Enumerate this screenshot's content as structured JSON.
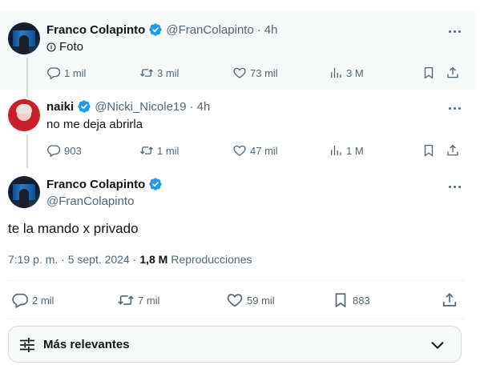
{
  "tweets": [
    {
      "name": "Franco Colapinto",
      "handle": "@FranColapinto",
      "separator": "·",
      "time": "4h",
      "text": "Foto",
      "photo_icon": "info-circle-icon",
      "actions": {
        "replies": "1 mil",
        "retweets": "3 mil",
        "likes": "73 mil",
        "views": "3 M"
      }
    },
    {
      "name": "naiki",
      "handle": "@Nicki_Nicole19",
      "separator": "·",
      "time": "4h",
      "text": "no me deja abrirla",
      "actions": {
        "replies": "903",
        "retweets": "1 mil",
        "likes": "47 mil",
        "views": "1 M"
      }
    }
  ],
  "main": {
    "name": "Franco Colapinto",
    "handle": "@FranColapinto",
    "text": "te la mando x privado",
    "timestamp": "7:19 p. m. · 5 sept. 2024 ·",
    "views_count": "1,8 M",
    "views_label": "Reproducciones",
    "actions": {
      "replies": "2 mil",
      "retweets": "7 mil",
      "likes": "59 mil",
      "bookmarks": "883"
    }
  },
  "sort": {
    "label": "Más relevantes"
  },
  "colors": {
    "verified": "#1d9bf0",
    "secondary_text": "#536471",
    "primary_text": "#0f1419"
  }
}
